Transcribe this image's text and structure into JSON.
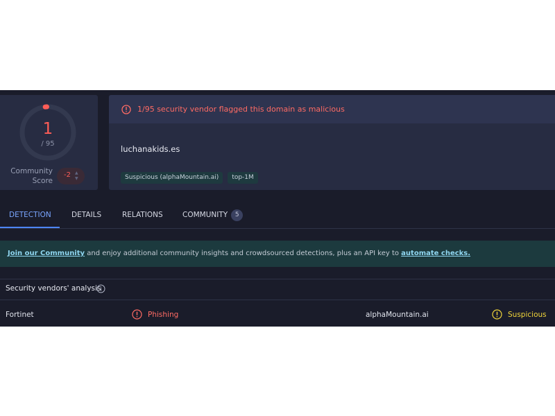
{
  "score": {
    "detections": "1",
    "total": "/ 95",
    "ring_fraction": 0.0105,
    "community_label_line1": "Community",
    "community_label_line2": "Score",
    "community_value": "-2"
  },
  "alert": {
    "text": "1/95 security vendor flagged this domain as malicious",
    "icon": "alert-circle-icon"
  },
  "domain": "luchanakids.es",
  "tags": [
    "Suspicious (alphaMountain.ai)",
    "top-1M"
  ],
  "tabs": [
    {
      "label": "DETECTION",
      "active": true
    },
    {
      "label": "DETAILS"
    },
    {
      "label": "RELATIONS"
    },
    {
      "label": "COMMUNITY",
      "count": "5"
    }
  ],
  "banner": {
    "link1": "Join our Community",
    "middle": " and enjoy additional community insights and crowdsourced detections, plus an API key to ",
    "link2": "automate checks."
  },
  "vendors": {
    "title": "Security vendors' analysis",
    "rows": [
      {
        "left_vendor": "Fortinet",
        "left_verdict": "Phishing",
        "right_vendor": "alphaMountain.ai",
        "right_verdict": "Suspicious"
      }
    ]
  },
  "colors": {
    "malicious": "#ff6b64",
    "suspicious": "#f0d43a",
    "accent": "#4d86ff"
  }
}
